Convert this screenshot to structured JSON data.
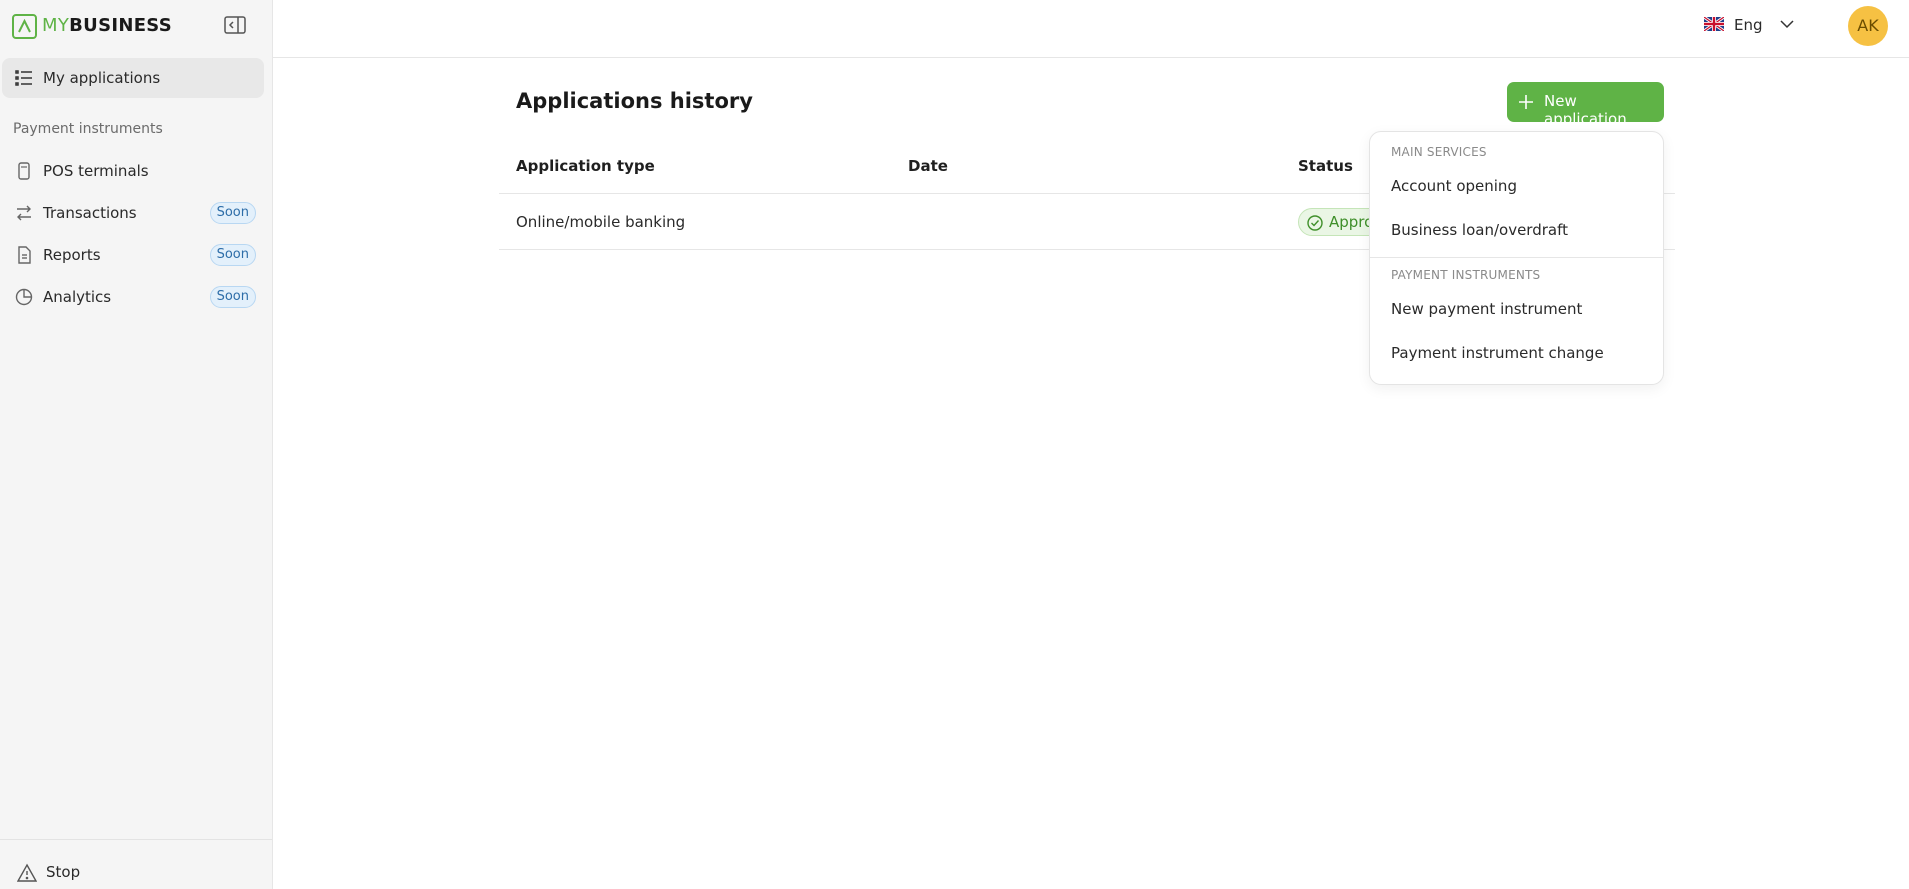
{
  "brand": {
    "name_prefix": "MY",
    "name_suffix": "BUSINESS"
  },
  "sidebar": {
    "top_item": {
      "label": "My applications"
    },
    "section_label": "Payment instruments",
    "items": [
      {
        "label": "POS terminals",
        "badge": ""
      },
      {
        "label": "Transactions",
        "badge": "Soon"
      },
      {
        "label": "Reports",
        "badge": "Soon"
      },
      {
        "label": "Analytics",
        "badge": "Soon"
      }
    ],
    "bottom_item": {
      "label": "Stop"
    }
  },
  "header": {
    "language": "Eng",
    "avatar_initials": "AK"
  },
  "main": {
    "title": "Applications history",
    "new_button_label": "New application",
    "table": {
      "columns": [
        "Application type",
        "Date",
        "Status"
      ],
      "rows": [
        {
          "type": "Online/mobile banking",
          "date": "",
          "status": "Appro"
        }
      ]
    }
  },
  "dropdown": {
    "sections": [
      {
        "title": "MAIN SERVICES",
        "items": [
          "Account opening",
          "Business loan/overdraft"
        ]
      },
      {
        "title": "PAYMENT INSTRUMENTS",
        "items": [
          "New payment instrument",
          "Payment instrument change"
        ]
      }
    ]
  },
  "colors": {
    "accent_green": "#5fb346",
    "badge_blue": "#2d6da8",
    "avatar_yellow": "#f6c143"
  }
}
